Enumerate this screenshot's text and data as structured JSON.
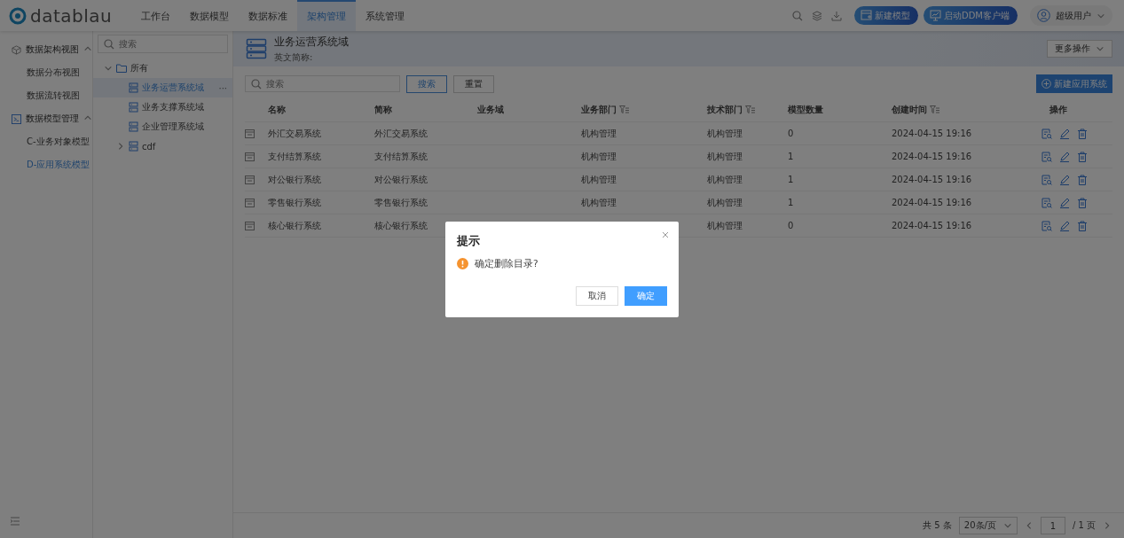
{
  "app": {
    "logo": "datablau"
  },
  "nav": [
    {
      "label": "工作台",
      "selected": false
    },
    {
      "label": "数据模型",
      "selected": false
    },
    {
      "label": "数据标准",
      "selected": false
    },
    {
      "label": "架构管理",
      "selected": true
    },
    {
      "label": "系统管理",
      "selected": false
    }
  ],
  "header_buttons": [
    {
      "label": "新建模型",
      "kind": "model"
    },
    {
      "label": "启动DDM客户端",
      "kind": "client"
    }
  ],
  "user": {
    "name": "超级用户"
  },
  "sidebar": [
    {
      "label": "数据架构视图",
      "kind": "cube",
      "expanded": true,
      "children": [
        {
          "label": "数据分布视图",
          "selected": false
        },
        {
          "label": "数据流转视图",
          "selected": false
        }
      ]
    },
    {
      "label": "数据模型管理",
      "kind": "model",
      "expanded": true,
      "children": [
        {
          "label": "C-业务对象模型",
          "selected": false
        },
        {
          "label": "D-应用系统模型",
          "selected": true
        }
      ]
    }
  ],
  "tree": {
    "placeholder": "搜索",
    "items": [
      {
        "label": "所有",
        "expanded": true,
        "selected": false,
        "children": [
          {
            "label": "业务运营系统域",
            "selected": true,
            "more": "···"
          },
          {
            "label": "业务支撑系统域",
            "selected": false
          },
          {
            "label": "企业管理系统域",
            "selected": false
          },
          {
            "label": "cdf",
            "selected": false,
            "expanded": false
          }
        ]
      }
    ]
  },
  "detail": {
    "title": "业务运营系统域",
    "subtitle": "英文简称:",
    "more_actions": "更多操作"
  },
  "toolbar": {
    "placeholder": "搜索",
    "search_button": "搜索",
    "reset_button": "重置",
    "new_button": "新建应用系统"
  },
  "table": {
    "columns": [
      {
        "label": "名称",
        "filter": false
      },
      {
        "label": "简称",
        "filter": false
      },
      {
        "label": "业务域",
        "filter": false
      },
      {
        "label": "业务部门",
        "filter": true
      },
      {
        "label": "技术部门",
        "filter": true
      },
      {
        "label": "模型数量",
        "filter": false
      },
      {
        "label": "创建时间",
        "filter": true
      },
      {
        "label": "操作",
        "filter": false
      }
    ],
    "rows": [
      [
        "外汇交易系统",
        "外汇交易系统",
        null,
        "机构管理",
        "机构管理",
        "0",
        "2024-04-15 19:16"
      ],
      [
        "支付结算系统",
        "支付结算系统",
        null,
        "机构管理",
        "机构管理",
        "1",
        "2024-04-15 19:16"
      ],
      [
        "对公银行系统",
        "对公银行系统",
        null,
        "机构管理",
        "机构管理",
        "1",
        "2024-04-15 19:16"
      ],
      [
        "零售银行系统",
        "零售银行系统",
        null,
        "机构管理",
        "机构管理",
        "1",
        "2024-04-15 19:16"
      ],
      [
        "核心银行系统",
        "核心银行系统",
        null,
        null,
        "机构管理",
        "0",
        "2024-04-15 19:16"
      ]
    ]
  },
  "pagination": {
    "total": "共 5 条",
    "page_size": "20条/页",
    "page": "1",
    "pages": "/ 1 页"
  },
  "dialog": {
    "title": "提示",
    "message": "确定删除目录?",
    "cancel": "取消",
    "confirm": "确定"
  }
}
